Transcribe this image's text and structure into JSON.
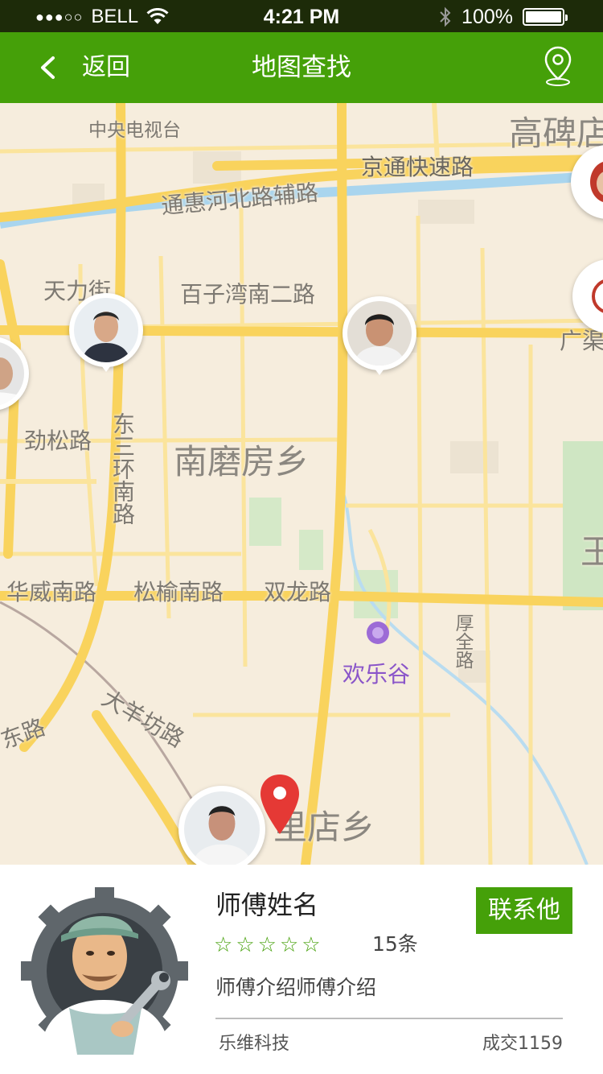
{
  "status_bar": {
    "signal": "●●●○○",
    "carrier": "BELL",
    "time": "4:21 PM",
    "battery": "100%"
  },
  "nav": {
    "back_label": "返回",
    "title": "地图查找"
  },
  "map": {
    "labels": {
      "cctv": "中央电视台",
      "gaobeidian": "高碑店",
      "jingtong": "京通快速路",
      "tonghui": "通惠河北路辅路",
      "tianli": "天力街",
      "baiziwan": "百子湾南二路",
      "guangqu": "广渠",
      "jinsong": "劲松路",
      "dongsanhuan": "东三环南路",
      "nanmofang": "南磨房乡",
      "wang": "王",
      "huawei": "华威南路",
      "songyu": "松榆南路",
      "shuanglong": "双龙路",
      "huanlegu": "欢乐谷",
      "houjin": "厚全路",
      "dayangfang": "大羊坊路",
      "lu": "东路",
      "lidian": "里店乡"
    }
  },
  "card": {
    "name": "师傅姓名",
    "contact_label": "联系他",
    "stars": [
      "☆",
      "☆",
      "☆",
      "☆",
      "☆"
    ],
    "review_count": "15条",
    "intro": "师傅介绍师傅介绍",
    "company": "乐维科技",
    "deals": "成交1159"
  },
  "colors": {
    "status_bar": "#1d2b09",
    "nav_bar": "#45a009",
    "accent": "#45a009",
    "map_bg": "#f6eddd",
    "road_major": "#f9d35d",
    "marker": "#e53935"
  }
}
